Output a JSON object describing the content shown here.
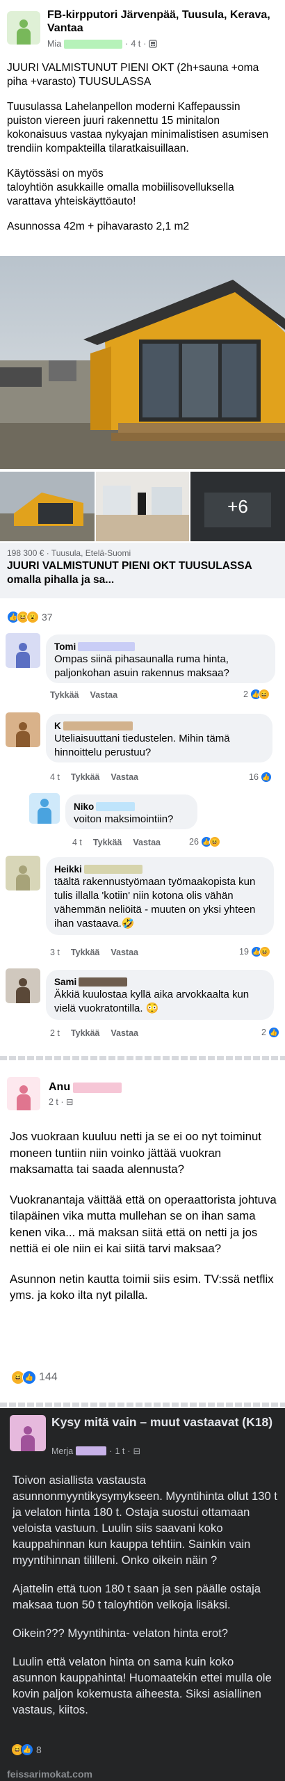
{
  "post1": {
    "group_title": "FB-kirpputori Järvenpää, Tuusula, Kerava, Vantaa",
    "author": "Mia",
    "time": "4 t",
    "paragraphs": [
      "JUURI VALMISTUNUT PIENI OKT (2h+sauna +oma piha +varasto) TUUSULASSA",
      "Tuusulassa Lahelanpellon moderni Kaffepaussin puiston viereen juuri rakennettu 15 minitalon kokonaisuus vastaa nykyajan minimalistisen asumisen trendiin kompakteilla tilaratkaisuillaan.",
      "Käytössäsi on myös\n taloyhtiön asukkaille omalla mobiilisovelluksella varattava yhteiskäyttöauto!",
      "Asunnossa 42m + pihavarasto 2,1 m2"
    ],
    "more_photos": "+6",
    "marketplace": {
      "meta": "198 300 € · Tuusula, Etelä-Suomi",
      "title": "JUURI VALMISTUNUT PIENI OKT TUUSULASSA omalla pihalla ja sa..."
    },
    "reaction_count": "37",
    "comments": [
      {
        "name": "Tomi",
        "text": "Ompas siinä pihasaunalla ruma hinta, paljonkohan asuin rakennus maksaa?",
        "time": "",
        "like": "Tykkää",
        "reply": "Vastaa",
        "reacts": "2"
      },
      {
        "name": "K",
        "text": "Uteliaisuuttani tiedustelen. Mihin tämä hinnoittelu perustuu?",
        "time": "4 t",
        "like": "Tykkää",
        "reply": "Vastaa",
        "reacts": "16"
      },
      {
        "name": "Niko",
        "text": "voiton maksimointiin?",
        "time": "4 t",
        "like": "Tykkää",
        "reply": "Vastaa",
        "reacts": "26"
      },
      {
        "name": "Heikki",
        "text": "täältä rakennustyömaan työmaakopista kun tulis illalla 'kotiin' niin kotona olis vähän vähemmän neliöitä - muuten on yksi yhteen ihan vastaava.🤣",
        "time": "3 t",
        "like": "Tykkää",
        "reply": "Vastaa",
        "reacts": "19"
      },
      {
        "name": "Sami",
        "text": "Äkkiä kuulostaa kyllä aika arvokkaalta kun vielä vuokratontilla. 😳",
        "time": "2 t",
        "like": "Tykkää",
        "reply": "Vastaa",
        "reacts": "2"
      }
    ]
  },
  "post2": {
    "author": "Anu",
    "time": "2 t",
    "paragraphs": [
      "Jos vuokraan kuuluu netti ja se ei oo nyt toiminut moneen tuntiin niin voinko jättää vuokran maksamatta tai saada alennusta?",
      "Vuokranantaja väittää että on operaattorista johtuva tilapäinen vika mutta mullehan se on ihan sama kenen vika... mä maksan siitä että on netti ja jos nettiä ei ole niin ei kai siitä tarvi maksaa?",
      "Asunnon netin kautta toimii siis esim. TV:ssä netflix yms. ja koko ilta nyt pilalla."
    ],
    "reaction_count": "144"
  },
  "post3": {
    "group_title": "Kysy mitä vain – muut vastaavat  (K18)",
    "author": "Merja",
    "time": "1 t",
    "paragraphs": [
      "Toivon asiallista vastausta asunnonmyyntikysymykseen. Myyntihinta ollut 130 t ja velaton hinta 180 t. Ostaja suostui ottamaan veloista vastuun. Luulin siis saavani koko kauppahinnan kun kauppa tehtiin. Sainkin vain myyntihinnan tililleni. Onko oikein näin ?",
      "Ajattelin että tuon 180 t saan ja sen päälle ostaja maksaa tuon 50 t taloyhtiön velkoja lisäksi.",
      "Oikein???  Myyntihinta- velaton hinta erot?",
      "Luulin että velaton hinta on sama kuin koko asunnon kauppahinta! Huomaatekin ettei mulla ole kovin paljon kokemusta aiheesta. Siksi asiallinen vastaus, kiitos."
    ],
    "reaction_count": "8"
  },
  "footer": "feissarimokat.com",
  "colors": {
    "fb_blue": "#1877f2",
    "text_secondary": "#65676b",
    "bubble_bg": "#f0f2f5",
    "dark_bg": "#242526",
    "house_yellow": "#e1a21c"
  },
  "icons": [
    "globe-icon",
    "like-icon",
    "haha-icon",
    "love-icon",
    "wow-icon",
    "person-avatar-icon"
  ]
}
